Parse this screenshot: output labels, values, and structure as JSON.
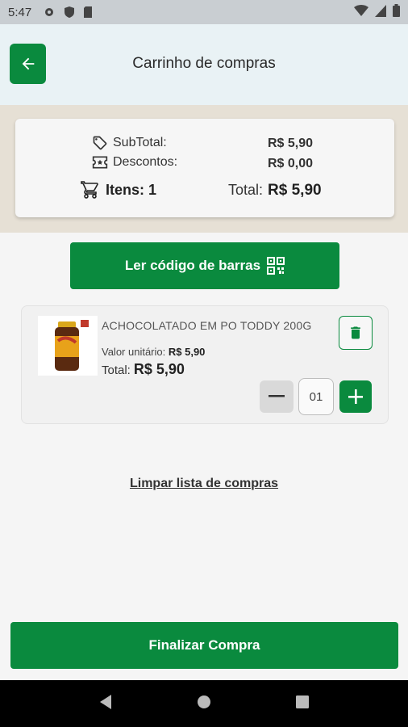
{
  "status_bar": {
    "time": "5:47"
  },
  "header": {
    "title": "Carrinho de compras"
  },
  "summary": {
    "subtotal_label": "SubTotal:",
    "subtotal_value": "R$ 5,90",
    "discounts_label": "Descontos:",
    "discounts_value": "R$ 0,00",
    "items_label": "Itens: 1",
    "total_label": "Total:",
    "total_value": "R$ 5,90"
  },
  "scan_button": {
    "label": "Ler código de barras"
  },
  "cart_items": [
    {
      "name": "ACHOCOLATADO EM PO TODDY 200G",
      "unit_label": "Valor unitário:",
      "unit_value": "R$ 5,90",
      "total_label": "Total:",
      "total_value": "R$ 5,90",
      "quantity": "01"
    }
  ],
  "clear_link": "Limpar lista de compras",
  "finish_button": "Finalizar Compra",
  "colors": {
    "primary": "#0a8a3e",
    "header_bg": "#e9f2f5",
    "summary_band": "#e6e0d5"
  }
}
